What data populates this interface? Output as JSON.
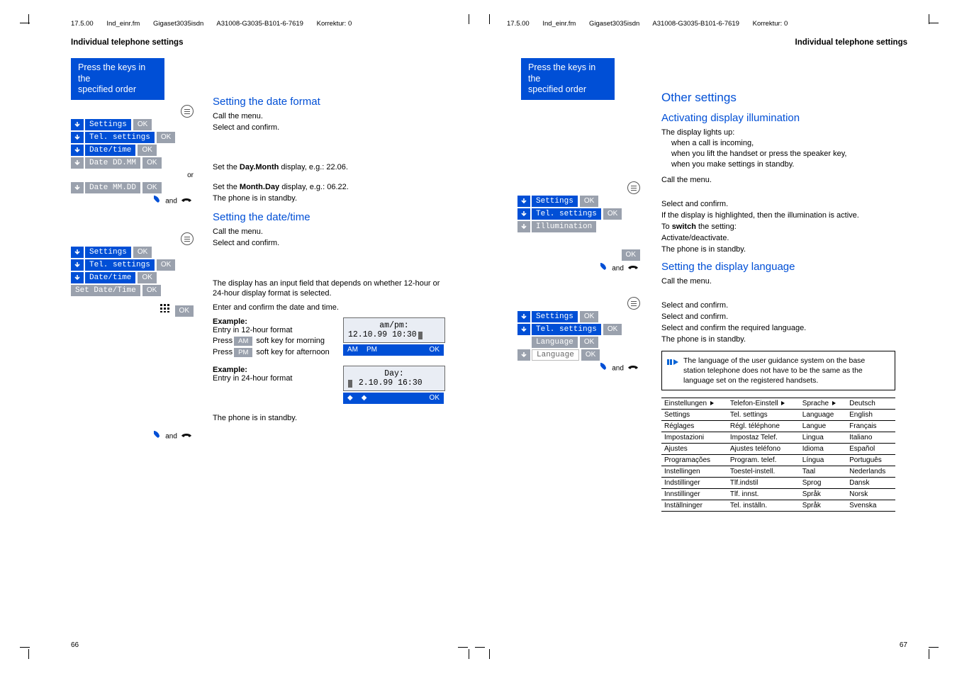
{
  "running": {
    "date": "17.5.00",
    "file": "Ind_einr.fm",
    "product": "Gigaset3035isdn",
    "doc": "A31008-G3035-B101-6-7619",
    "korr": "Korrektur: 0"
  },
  "section_title": "Individual telephone settings",
  "keybox": {
    "l1": "Press the keys in the",
    "l2": "specified order"
  },
  "left": {
    "h2a": "Setting the date format",
    "call_menu": "Call the menu.",
    "select_confirm": "Select and confirm.",
    "menu": {
      "settings": "Settings",
      "tel": "Tel. settings",
      "datetime": "Date/time",
      "dateDDMM": "Date DD.MM",
      "dateMMDD": "Date MM.DD",
      "set": "Set Date/Time",
      "lang": "Language",
      "illum": "Illumination",
      "language_word": "Language"
    },
    "ok": "OK",
    "or": "or",
    "and": "and",
    "set_daymonth1": "Set the ",
    "set_daymonth_bold": "Day.Month",
    "set_daymonth2": " display, e.g.: 22.06.",
    "set_monthday1": "Set the ",
    "set_monthday_bold": "Month.Day",
    "set_monthday2": " display, e.g.: 06.22.",
    "standby": "The phone is in standby.",
    "h2b": "Setting the date/time",
    "inputfield": "The display has an input field that depends on whether 12-hour or 24-hour display format is selected.",
    "enter_confirm": "Enter and confirm the date and time.",
    "ex_label": "Example:",
    "ex12": "Entry in 12-hour format",
    "ex24": "Entry in 24-hour format",
    "press": "Press",
    "softAM": "AM",
    "softPM": "PM",
    "soft_morning": " soft key for morning",
    "soft_afternoon": " soft key for afternoon",
    "lcd12_l1": "am/pm:",
    "lcd12_l2": "12.10.99 10:30",
    "lcd24_l1": "Day:",
    "lcd24_l2": " 2.10.99 16:30",
    "diamond": "◆",
    "diamond2": "◆",
    "pageno": "66"
  },
  "right": {
    "h1": "Other settings",
    "h2a": "Activating display illumination",
    "lights_up": "The display lights up:",
    "li1": "when a call is incoming,",
    "li2": "when you lift the handset or press the speaker key,",
    "li3": "when you make settings in standby.",
    "call_menu": "Call the menu.",
    "select_confirm": "Select and confirm.",
    "if_highlight": "If the display is highlighted, then the illumination is active.",
    "to_switch1": "To ",
    "to_switch_bold": "switch",
    "to_switch2": " the setting:",
    "act_deact": "Activate/deactivate.",
    "standby": "The phone is in standby.",
    "h2b": "Setting the display language",
    "select_lang": "Select and confirm the required language.",
    "note": "The language of the user guidance system on the base station telephone does not have to be the same as the language set on the registered handsets.",
    "pageno": "67",
    "table": [
      [
        "Einstellungen",
        "Telefon-Einstell",
        "Sprache",
        "Deutsch"
      ],
      [
        "Settings",
        "Tel. settings",
        "Language",
        "English"
      ],
      [
        "Réglages",
        "Régl. téléphone",
        "Langue",
        "Français"
      ],
      [
        "Impostazioni",
        "Impostaz Telef.",
        "Lingua",
        "Italiano"
      ],
      [
        "Ajustes",
        "Ajustes teléfono",
        "Idioma",
        "Español"
      ],
      [
        "Programações",
        "Program. telef.",
        "Língua",
        "Português"
      ],
      [
        "Instellingen",
        "Toestel-instell.",
        "Taal",
        "Nederlands"
      ],
      [
        "Indstillinger",
        "Tlf.indstil",
        "Sprog",
        "Dansk"
      ],
      [
        "Innstillinger",
        "Tlf. innst.",
        "Språk",
        "Norsk"
      ],
      [
        "Inställninger",
        "Tel. inställn.",
        "Språk",
        "Svenska"
      ]
    ]
  }
}
